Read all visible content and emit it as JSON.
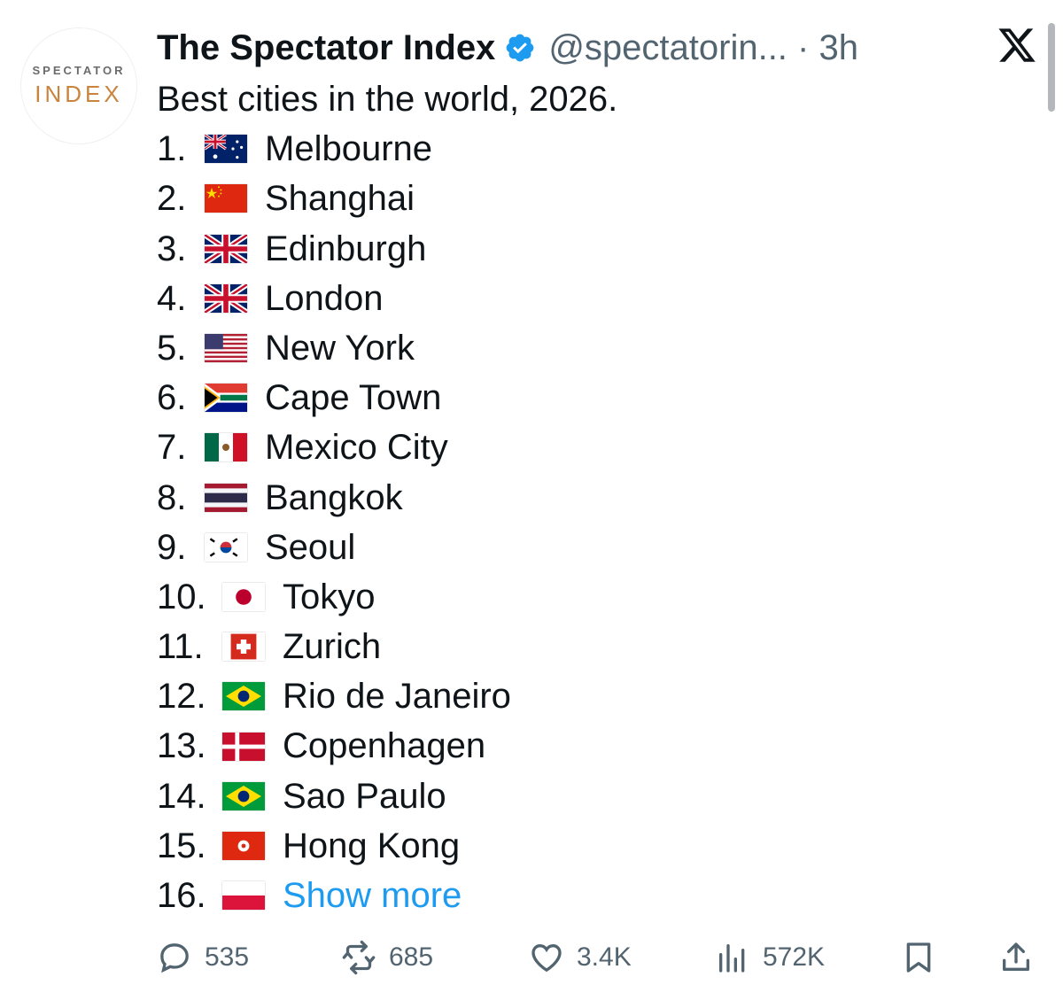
{
  "avatar": {
    "line1": "SPECTATOR",
    "line2": "INDEX"
  },
  "author": {
    "name": "The Spectator Index",
    "handle_time": "@spectatorin... · 3h"
  },
  "tweet": {
    "headline": "Best cities in the world, 2026.",
    "items": [
      {
        "rank": "1.",
        "flag": "australia-flag-icon",
        "city": "Melbourne"
      },
      {
        "rank": "2.",
        "flag": "china-flag-icon",
        "city": "Shanghai"
      },
      {
        "rank": "3.",
        "flag": "uk-flag-icon",
        "city": "Edinburgh"
      },
      {
        "rank": "4.",
        "flag": "uk-flag-icon",
        "city": "London"
      },
      {
        "rank": "5.",
        "flag": "usa-flag-icon",
        "city": "New York"
      },
      {
        "rank": "6.",
        "flag": "south-africa-flag-icon",
        "city": "Cape Town"
      },
      {
        "rank": "7.",
        "flag": "mexico-flag-icon",
        "city": "Mexico City"
      },
      {
        "rank": "8.",
        "flag": "thailand-flag-icon",
        "city": "Bangkok"
      },
      {
        "rank": "9.",
        "flag": "south-korea-flag-icon",
        "city": "Seoul"
      },
      {
        "rank": "10.",
        "flag": "japan-flag-icon",
        "city": "Tokyo"
      },
      {
        "rank": "11.",
        "flag": "switzerland-flag-icon",
        "city": "Zurich"
      },
      {
        "rank": "12.",
        "flag": "brazil-flag-icon",
        "city": "Rio de Janeiro"
      },
      {
        "rank": "13.",
        "flag": "denmark-flag-icon",
        "city": "Copenhagen"
      },
      {
        "rank": "14.",
        "flag": "brazil-flag-icon",
        "city": "Sao Paulo"
      },
      {
        "rank": "15.",
        "flag": "hong-kong-flag-icon",
        "city": "Hong Kong"
      },
      {
        "rank": "16.",
        "flag": "poland-flag-icon",
        "city": "Show more"
      }
    ]
  },
  "actions": {
    "replies": "535",
    "reposts": "685",
    "likes": "3.4K",
    "views": "572K"
  },
  "colors": {
    "link": "#1d9bf0",
    "muted": "#536471",
    "verified": "#1d9bf0"
  }
}
